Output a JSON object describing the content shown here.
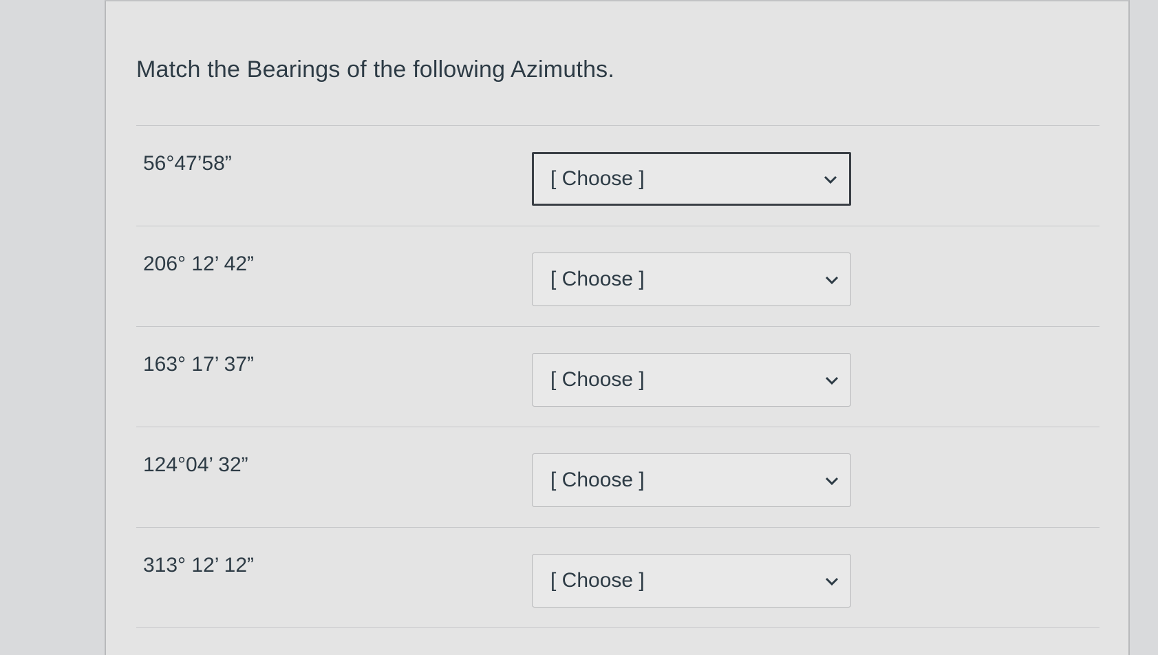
{
  "question": {
    "title": "Match the Bearings of the following Azimuths."
  },
  "rows": [
    {
      "azimuth": "56°47’58”",
      "selected": "[ Choose ]"
    },
    {
      "azimuth": "206° 12’ 42”",
      "selected": "[ Choose ]"
    },
    {
      "azimuth": "163° 17’ 37”",
      "selected": "[ Choose ]"
    },
    {
      "azimuth": "124°04’ 32”",
      "selected": "[ Choose ]"
    },
    {
      "azimuth": "313° 12’ 12”",
      "selected": "[ Choose ]"
    }
  ],
  "icons": {
    "dropdown": "chevron-down-icon"
  }
}
